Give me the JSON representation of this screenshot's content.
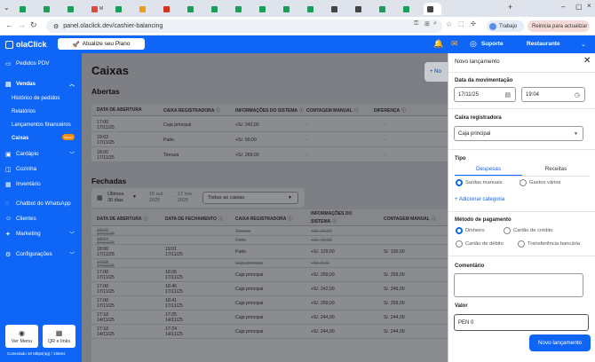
{
  "browser": {
    "url": "panel.olaclick.dev/cashier-balancing",
    "profile_label": "Trabajo",
    "update_label": "Reinicia para actualizar",
    "tab_letters": [
      "",
      "",
      "",
      "M",
      "",
      "",
      "",
      "",
      "",
      "",
      "",
      "",
      "",
      "",
      "",
      "",
      "",
      ""
    ]
  },
  "header": {
    "logo": "olaClick",
    "upgrade_label": "Atualize seu Plano",
    "support_label": "Suporte",
    "restaurant_label": "Restaurante"
  },
  "sidebar": {
    "pedidos_pdv": "Pedidos PDV",
    "vendas": "Vendas",
    "historico": "Histórico de pedidos",
    "relatorios": "Relatórios",
    "lancamentos": "Lançamentos financeiros",
    "caixas": "Caixas",
    "caixas_badge": "Novo",
    "cardapio": "Cardápio",
    "cozinha": "Cozinha",
    "inventario": "Inventário",
    "chatbot": "Chatbot do WhatsApp",
    "clientes": "Clientes",
    "marketing": "Marketing",
    "configuracoes": "Configurações",
    "ver_menu": "Ver Menu",
    "qr_links": "QR e links",
    "connection": "Conectado 10 Mbps(4g) / 150ms"
  },
  "main": {
    "title": "Caixas",
    "novo_btn": "+ No",
    "abertas_title": "Abertas",
    "abertas_headers": [
      "DATA DE ABERTURA",
      "CAIXA REGISTRADORA",
      "INFORMAÇÕES DO SISTEMA",
      "CONTAGEM MANUAL",
      "DIFERENÇA"
    ],
    "abertas_rows": [
      {
        "time": "17:00",
        "date": "17/11/25",
        "caixa": "Caja principal",
        "info": "+S/. 242,00",
        "contagem": "-",
        "diferenca": "-"
      },
      {
        "time": "19:02",
        "date": "17/11/25",
        "caixa": "Patio",
        "info": "+S/. 50,00",
        "contagem": "-",
        "diferenca": "-"
      },
      {
        "time": "18:00",
        "date": "17/11/25",
        "caixa": "Terraza",
        "info": "+S/. 269,00",
        "contagem": "-",
        "diferenca": "-"
      }
    ],
    "fechadas_title": "Fechadas",
    "filter_period_label": "Últimos",
    "filter_period_value": "30 dias",
    "filter_from": "16 out",
    "filter_from_year": "2025",
    "filter_dash": "-",
    "filter_to": "17 nov",
    "filter_to_year": "2025",
    "filter_caixas": "Todas as caixas",
    "fechadas_headers": [
      "DATA DE ABERTURA",
      "DATA DE FECHAMENTO",
      "CAIXA REGISTRADORA",
      "INFORMAÇÕES DO",
      "SISTEMA",
      "CONTAGEM MANUAL"
    ],
    "fechadas_rows": [
      {
        "open_time": "18:00",
        "open_date": "17/11/25",
        "close_time": "",
        "close_date": "",
        "caixa": "Terraza",
        "info": "+S/. 20,00",
        "contagem": "",
        "muted": true
      },
      {
        "open_time": "18:07",
        "open_date": "17/11/25",
        "close_time": "",
        "close_date": "",
        "caixa": "Patio",
        "info": "+S/. 40,00",
        "contagem": "",
        "muted": true
      },
      {
        "open_time": "18:00",
        "open_date": "17/11/25",
        "close_time": "19:01",
        "close_date": "17/11/25",
        "caixa": "Patio",
        "info": "+S/. 129,00",
        "contagem": "S/. 100,00",
        "muted": false
      },
      {
        "open_time": "17:53",
        "open_date": "17/11/25",
        "close_time": "",
        "close_date": "",
        "caixa": "Caja principal",
        "info": "+S/. 0,00",
        "contagem": "",
        "muted": true
      },
      {
        "open_time": "17:00",
        "open_date": "17/11/25",
        "close_time": "18:06",
        "close_date": "17/11/25",
        "caixa": "Caja principal",
        "info": "+S/. 259,00",
        "contagem": "S/. 259,00",
        "muted": false
      },
      {
        "open_time": "17:00",
        "open_date": "17/11/25",
        "close_time": "18:46",
        "close_date": "17/11/25",
        "caixa": "Caja principal",
        "info": "+S/. 242,00",
        "contagem": "S/. 249,00",
        "muted": false
      },
      {
        "open_time": "17:00",
        "open_date": "17/11/25",
        "close_time": "18:41",
        "close_date": "17/11/25",
        "caixa": "Caja principal",
        "info": "+S/. 259,00",
        "contagem": "S/. 259,00",
        "muted": false
      },
      {
        "open_time": "17:18",
        "open_date": "14/11/25",
        "close_time": "17:25",
        "close_date": "14/11/25",
        "caixa": "Caja principal",
        "info": "+S/. 244,00",
        "contagem": "S/. 244,00",
        "muted": false
      },
      {
        "open_time": "17:18",
        "open_date": "14/11/25",
        "close_time": "17:24",
        "close_date": "14/11/25",
        "caixa": "Caja principal",
        "info": "+S/. 244,00",
        "contagem": "S/. 244,00",
        "muted": false
      }
    ]
  },
  "panel": {
    "title": "Novo lançamento",
    "date_label": "Data da movimentação",
    "date_value": "17/11/25",
    "time_value": "19:04",
    "caixa_label": "Caixa registradora",
    "caixa_value": "Caja principal",
    "tipo_label": "Tipo",
    "tab_despesas": "Despesas",
    "tab_receitas": "Receitas",
    "saidas": "Saídas manuais",
    "gastos": "Gastos vários",
    "add_categoria": "+ Adicionar categoria",
    "pagamento_label": "Método de pagamento",
    "dinheiro": "Dinheiro",
    "credito": "Cartão de crédito",
    "debito": "Cartão de débito",
    "transferencia": "Transferência bancária",
    "comentario_label": "Comentário",
    "valor_label": "Valor",
    "valor_value": "PEN 0",
    "submit": "Novo lançamento"
  },
  "colors": {
    "brand": "#0f66f6",
    "badge": "#ff8a00"
  }
}
